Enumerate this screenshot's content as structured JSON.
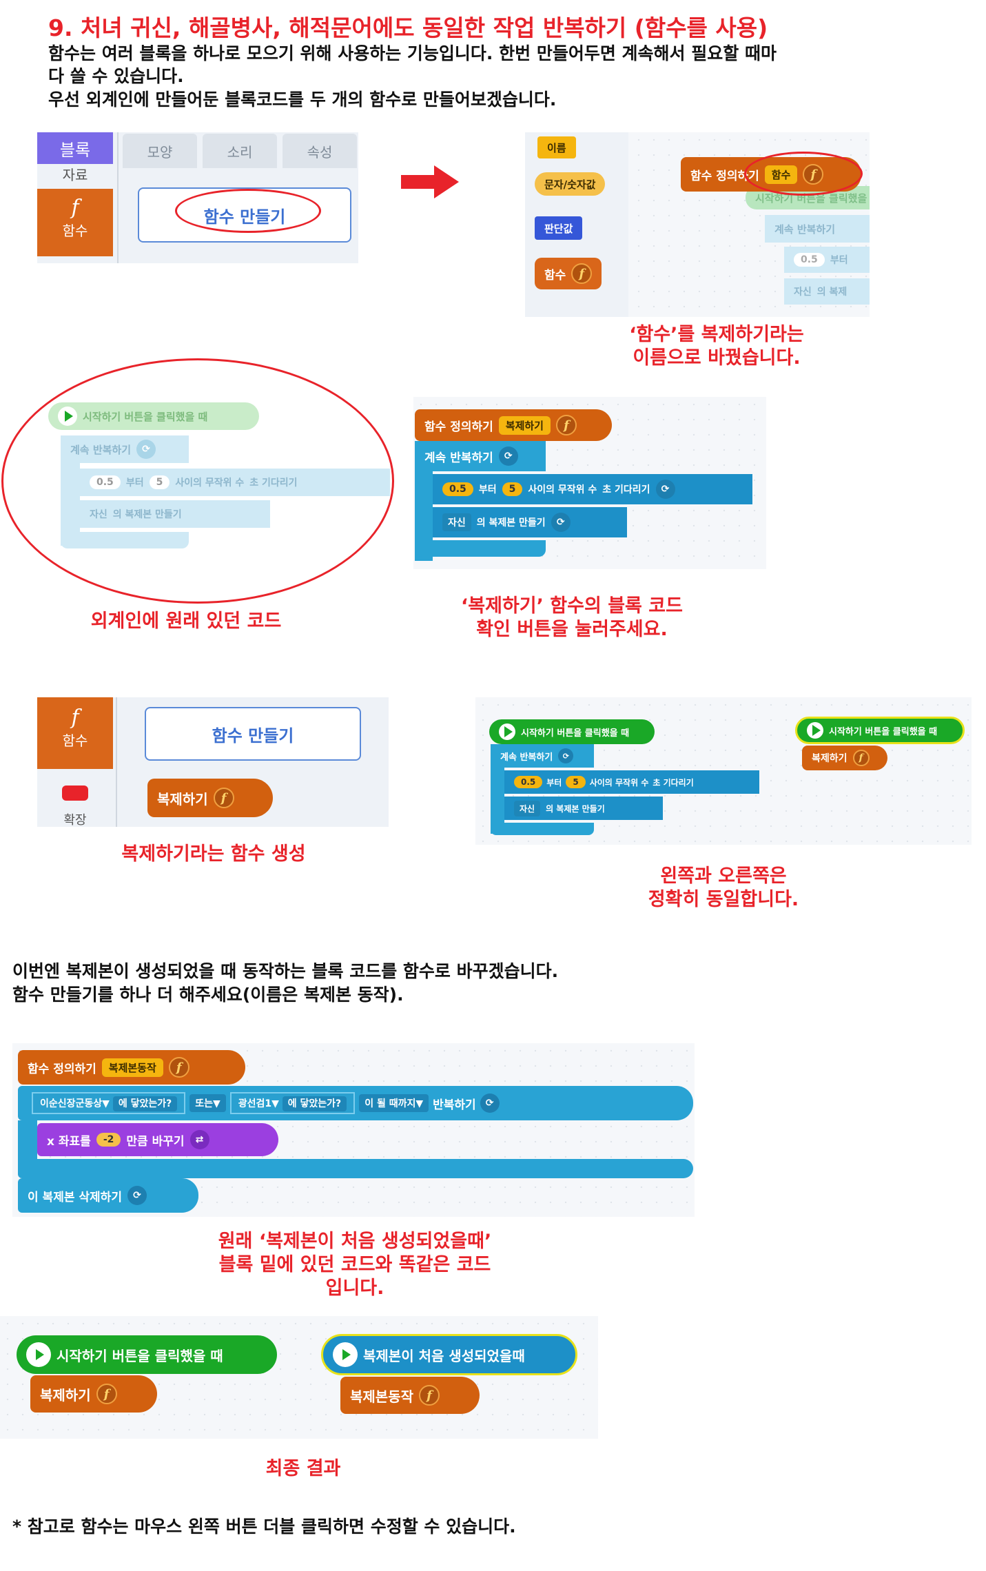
{
  "title": "9. 처녀 귀신, 해골병사, 해적문어에도 동일한 작업 반복하기 (함수를 사용)",
  "intro": [
    "함수는 여러 블록을 하나로 모으기 위해 사용하는 기능입니다. 한번 만들어두면 계속해서 필요할 때마",
    "다 쓸 수 있습니다.",
    "우선 외계인에 만들어둔 블록코드를 두 개의 함수로 만들어보겠습니다."
  ],
  "panel1": {
    "side_tab": "블록",
    "side_tab2": "자료",
    "side_func": "함수",
    "tabs": [
      "모양",
      "소리",
      "속성"
    ],
    "make_button": "함수 만들기"
  },
  "panel2": {
    "palette": [
      "이름",
      "문자/숫자값",
      "판단값",
      "함수"
    ],
    "define_label": "함수 정의하기",
    "define_name": "함수",
    "ghost_hat": "시작하기 버튼을 클릭했을 때",
    "ghost_loop": "계속 반복하기",
    "ghost_num": "0.5",
    "ghost_from": "부터",
    "ghost_self": "자신",
    "ghost_clone": "의 복제"
  },
  "caption1": [
    "‘함수’를 복제하기라는",
    "이름으로 바꿨습니다."
  ],
  "panel3": {
    "hat": "시작하기 버튼을 클릭했을 때",
    "loop": "계속 반복하기",
    "num1": "0.5",
    "from": "부터",
    "num2": "5",
    "random": "사이의 무작위 수",
    "wait": "초 기다리기",
    "self": "자신",
    "clone": "의 복제본 만들기"
  },
  "caption2": "외계인에 원래 있던 코드",
  "panel4": {
    "define_label": "함수 정의하기",
    "define_name": "복제하기",
    "loop": "계속 반복하기",
    "num1": "0.5",
    "from": "부터",
    "num2": "5",
    "random": "사이의 무작위 수",
    "wait": "초 기다리기",
    "self": "자신",
    "clone": "의 복제본 만들기"
  },
  "caption3": [
    "‘복제하기’ 함수의 블록 코드",
    "확인 버튼을 눌러주세요."
  ],
  "panel5": {
    "side_func": "함수",
    "side_ext": "확장",
    "make_button": "함수 만들기",
    "func_block": "복제하기"
  },
  "caption4": "복제하기라는 함수 생성",
  "panel6": {
    "hat_left": "시작하기 버튼을 클릭했을 때",
    "loop": "계속 반복하기",
    "num1": "0.5",
    "from": "부터",
    "num2": "5",
    "random": "사이의 무작위 수",
    "wait": "초 기다리기",
    "self": "자신",
    "clone": "의 복제본 만들기",
    "hat_right": "시작하기 버튼을 클릭했을 때",
    "func_right": "복제하기"
  },
  "caption5": [
    "왼쪽과 오른쪽은",
    "정확히 동일합니다."
  ],
  "text2": [
    "이번엔 복제본이 생성되었을 때 동작하는 블록 코드를 함수로 바꾸겠습니다.",
    "함수 만들기를 하나 더 해주세요(이름은 복제본 동작)."
  ],
  "panel7": {
    "define_label": "함수 정의하기",
    "define_name": "복제본동작",
    "sensor1": "이순신장군동상▼",
    "touch1": "에 닿았는가?",
    "or": "또는▼",
    "sensor2": "광선검1▼",
    "touch2": "에 닿았는가?",
    "until": "이 될 때까지▼",
    "repeat": "반복하기",
    "xlabel": "x 좌표를",
    "xval": "-2",
    "xchange": "만큼 바꾸기",
    "delete": "이 복제본 삭제하기"
  },
  "caption6": [
    "원래 ‘복제본이 처음 생성되었을때’",
    "블록 밑에 있던 코드와 똑같은 코드",
    "입니다."
  ],
  "panel8": {
    "hat_start": "시작하기 버튼을 클릭했을 때",
    "func1": "복제하기",
    "hat_clone": "복제본이 처음 생성되었을때",
    "func2": "복제본동작"
  },
  "caption7": "최종 결과",
  "footnote": "* 참고로 함수는 마우스 왼쪽 버튼 더블 클릭하면 수정할 수 있습니다."
}
